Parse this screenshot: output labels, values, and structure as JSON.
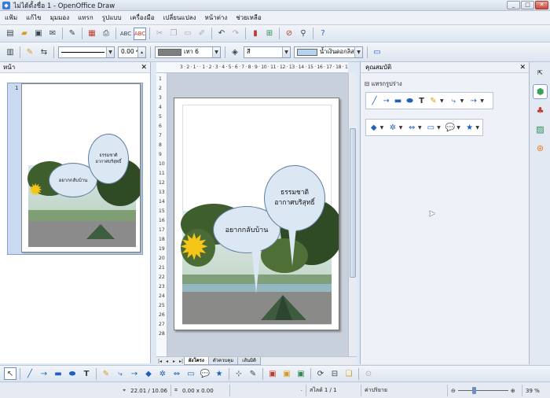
{
  "window": {
    "title": "ไม่ได้ตั้งชื่อ 1 - OpenOffice Draw"
  },
  "menu": [
    "แฟ้ม",
    "แก้ไข",
    "มุมมอง",
    "แทรก",
    "รูปแบบ",
    "เครื่องมือ",
    "เปลี่ยนแปลง",
    "หน้าต่าง",
    "ช่วยเหลือ"
  ],
  "line_toolbar": {
    "line_width": "0.00 ซม",
    "fill_color_name": "เทา 6",
    "area_style": "สี",
    "area_fill": "น้ำเงินดอกลิส"
  },
  "pages_panel": {
    "title": "หน้า",
    "page_number": "1"
  },
  "drawing": {
    "cloud_left": "อยากกลับบ้าน",
    "cloud_right_line1": "ธรรมชาติ",
    "cloud_right_line2": "อากาศบริสุทธิ์"
  },
  "ruler": {
    "h": "3 · 2 · 1 · · 1 · 2 · 3 · 4 · 5 · 6 · 7 · 8 · 9 · 10 · 11 · 12 · 13 · 14 · 15 · 16 · 17 · 18 · 19 · 20 · 21",
    "v": [
      "1",
      "2",
      "3",
      "4",
      "5",
      "6",
      "7",
      "8",
      "9",
      "10",
      "11",
      "12",
      "13",
      "14",
      "15",
      "16",
      "17",
      "18",
      "19",
      "20",
      "21",
      "22",
      "23",
      "24",
      "25",
      "26",
      "27",
      "28"
    ]
  },
  "tabs": [
    "ผังโครง",
    "ตัวควบคุม",
    "เส้นมิติ"
  ],
  "side_panel": {
    "title": "คุณสมบัติ",
    "section": "แทรกรูปร่าง"
  },
  "status": {
    "position": "22.01 / 10.06",
    "size": "0.00 x 0.00",
    "page": "สไลด์ 1 / 1",
    "layout": "ค่าปริยาย",
    "zoom": "39 %"
  },
  "colors": {
    "fill": "#7f7f7f",
    "area": "#b4d4f0",
    "cloud": "#dbe7f3",
    "sun": "#f5c518"
  }
}
